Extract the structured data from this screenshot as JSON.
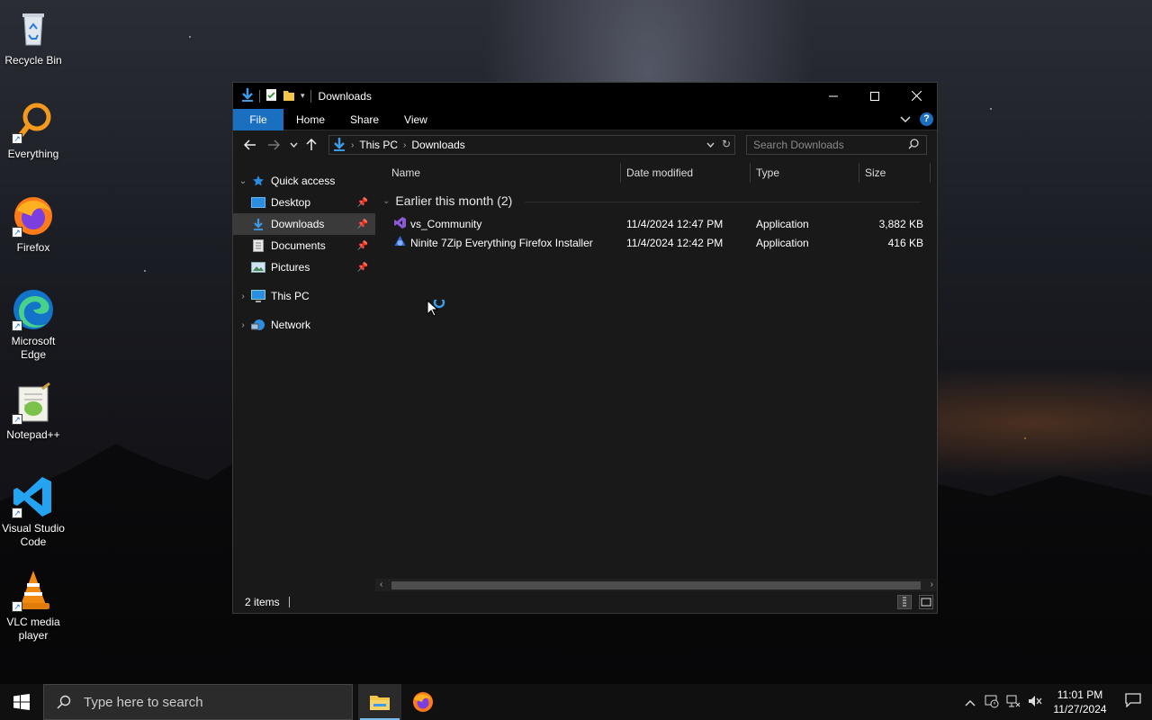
{
  "desktop": {
    "icons": [
      {
        "label": "Recycle Bin",
        "icon": "recycle-bin-icon"
      },
      {
        "label": "Everything",
        "icon": "everything-icon"
      },
      {
        "label": "Firefox",
        "icon": "firefox-icon"
      },
      {
        "label": "Microsoft Edge",
        "icon": "edge-icon"
      },
      {
        "label": "Notepad++",
        "icon": "notepadpp-icon"
      },
      {
        "label": "Visual Studio Code",
        "icon": "vscode-icon"
      },
      {
        "label": "VLC media player",
        "icon": "vlc-icon"
      }
    ]
  },
  "window": {
    "title": "Downloads",
    "ribbon": {
      "tabs": [
        "File",
        "Home",
        "Share",
        "View"
      ],
      "help": "?"
    },
    "address": {
      "crumbs": [
        "This PC",
        "Downloads"
      ]
    },
    "search": {
      "placeholder": "Search Downloads"
    },
    "nav_pane": {
      "quick_access": "Quick access",
      "items": [
        {
          "label": "Desktop",
          "pinned": true
        },
        {
          "label": "Downloads",
          "pinned": true,
          "selected": true
        },
        {
          "label": "Documents",
          "pinned": true
        },
        {
          "label": "Pictures",
          "pinned": true
        }
      ],
      "this_pc": "This PC",
      "network": "Network"
    },
    "columns": [
      "Name",
      "Date modified",
      "Type",
      "Size"
    ],
    "group": {
      "label": "Earlier this month (2)"
    },
    "files": [
      {
        "name": "vs_Community",
        "date": "11/4/2024 12:47 PM",
        "type": "Application",
        "size": "3,882 KB"
      },
      {
        "name": "Ninite 7Zip Everything Firefox Installer",
        "date": "11/4/2024 12:42 PM",
        "type": "Application",
        "size": "416 KB"
      }
    ],
    "status": {
      "count": "2 items"
    }
  },
  "taskbar": {
    "search_placeholder": "Type here to search",
    "clock_time": "11:01 PM",
    "clock_date": "11/27/2024"
  },
  "colors": {
    "accent": "#1a6fc1",
    "window_bg": "#191919",
    "titlebar": "#000000"
  }
}
